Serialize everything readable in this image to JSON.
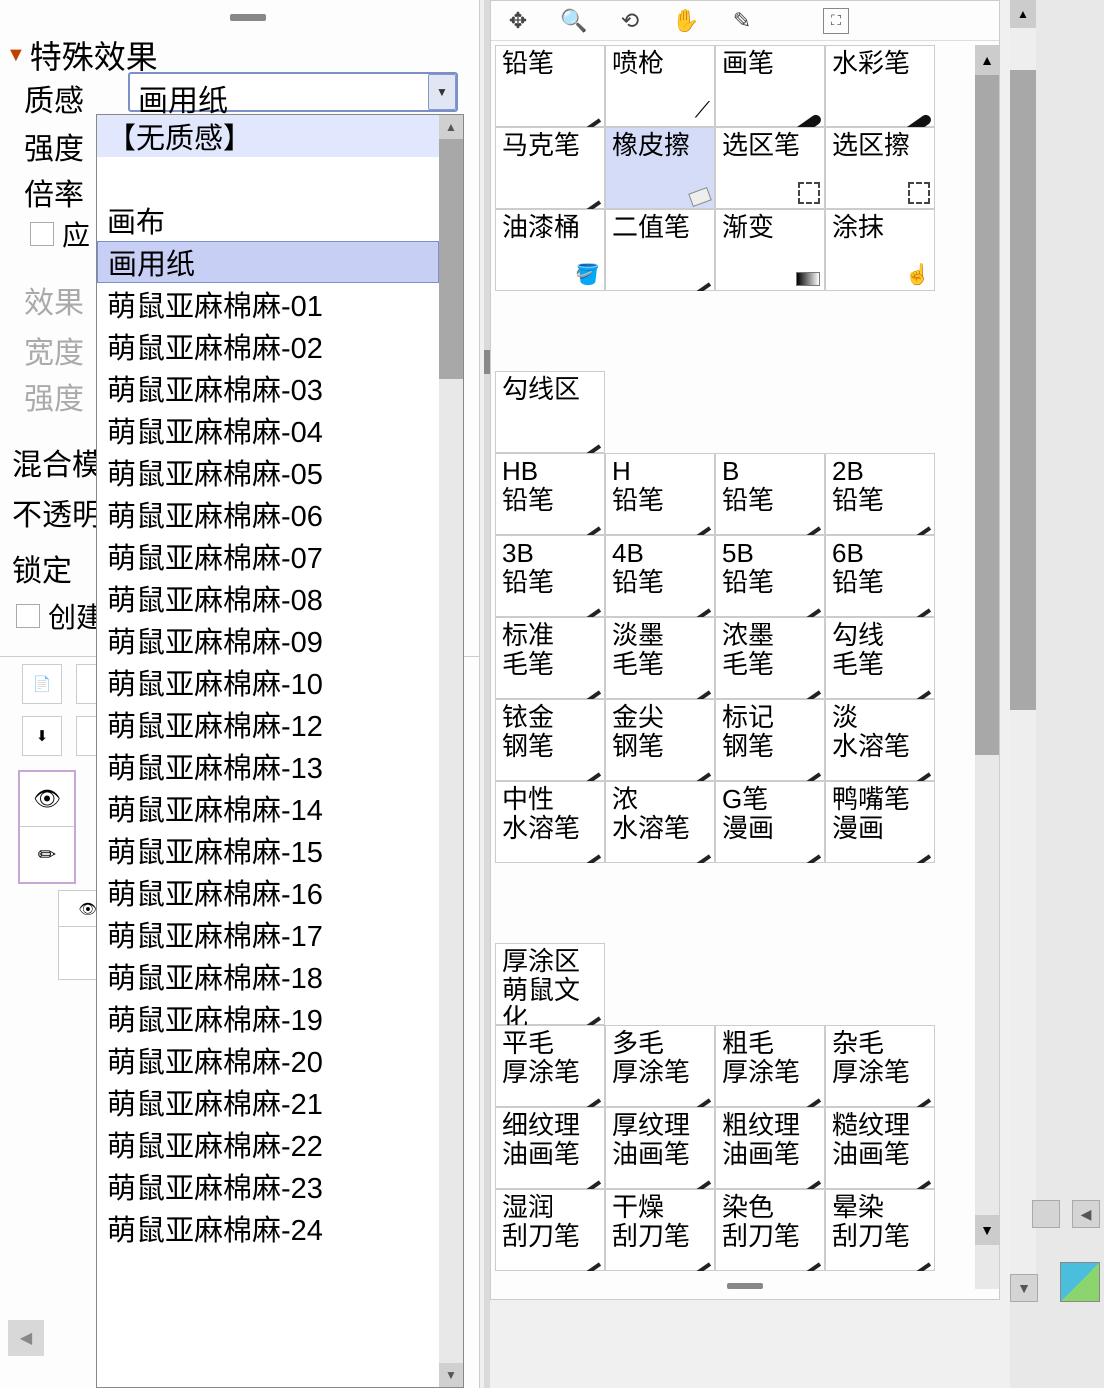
{
  "left": {
    "section_title": "特殊效果",
    "texture_label": "质感",
    "texture_value": "画用纸",
    "intensity_label": "强度",
    "scale_label": "倍率",
    "apply_label": "应",
    "effect_label": "效果",
    "width_label": "宽度",
    "intensity2_label": "强度",
    "blend_mode_label": "混合模",
    "opacity_label": "不透明",
    "lock_label": "锁定",
    "create_label": "创建"
  },
  "dropdown": {
    "items": [
      {
        "label": "【无质感】",
        "highlighted": true
      },
      {
        "label": "",
        "blank": true
      },
      {
        "label": "画布"
      },
      {
        "label": "画用纸",
        "selected": true
      },
      {
        "label": "萌鼠亚麻棉麻-01"
      },
      {
        "label": "萌鼠亚麻棉麻-02"
      },
      {
        "label": "萌鼠亚麻棉麻-03"
      },
      {
        "label": "萌鼠亚麻棉麻-04"
      },
      {
        "label": "萌鼠亚麻棉麻-05"
      },
      {
        "label": "萌鼠亚麻棉麻-06"
      },
      {
        "label": "萌鼠亚麻棉麻-07"
      },
      {
        "label": "萌鼠亚麻棉麻-08"
      },
      {
        "label": "萌鼠亚麻棉麻-09"
      },
      {
        "label": "萌鼠亚麻棉麻-10"
      },
      {
        "label": "萌鼠亚麻棉麻-12"
      },
      {
        "label": "萌鼠亚麻棉麻-13"
      },
      {
        "label": "萌鼠亚麻棉麻-14"
      },
      {
        "label": "萌鼠亚麻棉麻-15"
      },
      {
        "label": "萌鼠亚麻棉麻-16"
      },
      {
        "label": "萌鼠亚麻棉麻-17"
      },
      {
        "label": "萌鼠亚麻棉麻-18"
      },
      {
        "label": "萌鼠亚麻棉麻-19"
      },
      {
        "label": "萌鼠亚麻棉麻-20"
      },
      {
        "label": "萌鼠亚麻棉麻-21"
      },
      {
        "label": "萌鼠亚麻棉麻-22"
      },
      {
        "label": "萌鼠亚麻棉麻-23"
      },
      {
        "label": "萌鼠亚麻棉麻-24"
      }
    ]
  },
  "tools": {
    "row1": [
      "铅笔",
      "喷枪",
      "画笔",
      "水彩笔"
    ],
    "row2": [
      "马克笔",
      "橡皮擦",
      "选区笔",
      "选区擦"
    ],
    "row3": [
      "油漆桶",
      "二值笔",
      "渐变",
      "涂抹"
    ],
    "group_heading": "勾线区",
    "row4": [
      {
        "l1": "HB",
        "l2": "铅笔"
      },
      {
        "l1": "H",
        "l2": "铅笔"
      },
      {
        "l1": "B",
        "l2": "铅笔"
      },
      {
        "l1": "2B",
        "l2": "铅笔"
      }
    ],
    "row5": [
      {
        "l1": "3B",
        "l2": "铅笔"
      },
      {
        "l1": "4B",
        "l2": "铅笔"
      },
      {
        "l1": "5B",
        "l2": "铅笔"
      },
      {
        "l1": "6B",
        "l2": "铅笔"
      }
    ],
    "row6": [
      {
        "l1": "标准",
        "l2": "毛笔"
      },
      {
        "l1": "淡墨",
        "l2": "毛笔"
      },
      {
        "l1": "浓墨",
        "l2": "毛笔"
      },
      {
        "l1": "勾线",
        "l2": "毛笔"
      }
    ],
    "row7": [
      {
        "l1": "铱金",
        "l2": "钢笔"
      },
      {
        "l1": "金尖",
        "l2": "钢笔"
      },
      {
        "l1": "标记",
        "l2": "钢笔"
      },
      {
        "l1": "淡",
        "l2": "水溶笔"
      }
    ],
    "row8": [
      {
        "l1": "中性",
        "l2": "水溶笔"
      },
      {
        "l1": "浓",
        "l2": "水溶笔"
      },
      {
        "l1": "G笔",
        "l2": "漫画"
      },
      {
        "l1": "鸭嘴笔",
        "l2": "漫画"
      }
    ],
    "group_heading2a": "厚涂区",
    "group_heading2b": "萌鼠文化",
    "row9": [
      {
        "l1": "平毛",
        "l2": "厚涂笔"
      },
      {
        "l1": "多毛",
        "l2": "厚涂笔"
      },
      {
        "l1": "粗毛",
        "l2": "厚涂笔"
      },
      {
        "l1": "杂毛",
        "l2": "厚涂笔"
      }
    ],
    "row10": [
      {
        "l1": "细纹理",
        "l2": "油画笔"
      },
      {
        "l1": "厚纹理",
        "l2": "油画笔"
      },
      {
        "l1": "粗纹理",
        "l2": "油画笔"
      },
      {
        "l1": "糙纹理",
        "l2": "油画笔"
      }
    ],
    "row11": [
      {
        "l1": "湿润",
        "l2": "刮刀笔"
      },
      {
        "l1": "干燥",
        "l2": "刮刀笔"
      },
      {
        "l1": "染色",
        "l2": "刮刀笔"
      },
      {
        "l1": "晕染",
        "l2": "刮刀笔"
      }
    ]
  },
  "selected_tool_row2_index": 1
}
